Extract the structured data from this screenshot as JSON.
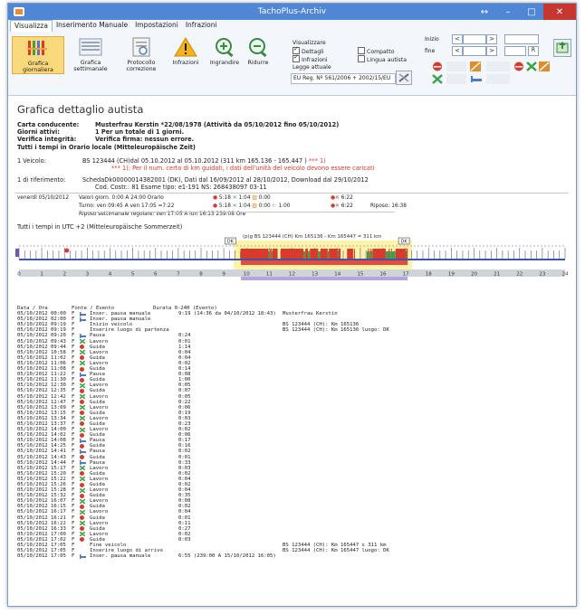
{
  "window": {
    "title": "TachoPlus-Archiv",
    "controls": {
      "extra": "↔",
      "minimize": "–",
      "maximize": "□",
      "close": "✕"
    }
  },
  "menu_tabs": [
    "Visualizza",
    "Inserimento Manuale",
    "Impostazioni",
    "Infrazioni"
  ],
  "toolbar": {
    "buttons": [
      {
        "label": "Grafica giornaliera",
        "icon": "daily-chart-icon"
      },
      {
        "label": "Grafica settimanale",
        "icon": "weekly-chart-icon"
      },
      {
        "label": "Protocollo correzione",
        "icon": "protocol-icon"
      },
      {
        "label": "Infrazioni",
        "icon": "warning-icon"
      },
      {
        "label": "Ingrandire",
        "icon": "zoom-in-icon"
      },
      {
        "label": "Ridurre",
        "icon": "zoom-out-icon"
      }
    ],
    "visualizzare": {
      "title": "Visualizzare",
      "options": [
        {
          "label": "Dettagli",
          "checked": true
        },
        {
          "label": "Compatto",
          "checked": false
        },
        {
          "label": "Infrazioni",
          "checked": true
        },
        {
          "label": "Lingua autista",
          "checked": false
        }
      ],
      "legge_label": "Legge attuale",
      "legge_value": "EU Reg. Nº 561/2006 + 2002/15/EU"
    },
    "range": {
      "inizio_label": "Inizio",
      "fine_label": "fine",
      "nav_prev": "<",
      "nav_next": ">",
      "r_button": "R"
    }
  },
  "report": {
    "title": "Grafica dettaglio autista",
    "conducente_label": "Carta conducente:",
    "conducente_value": "Musterfrau Kerstin *22/08/1978  (Attività da 05/10/2012 fino 05/10/2012)",
    "giorni_label": "Giorni attivi:",
    "giorni_value": "1 Per un totale di 1 giorni.",
    "verifica_label": "Verifica integrità:",
    "verifica_value": "Verifica firma: nessun errore.",
    "tempi": "Tutti i tempi in Orario locale (Mitteleuropäische Zeit)",
    "veicolo_label": "1 Veicolo:",
    "veicolo_value": "BS 123444 (CH)dal 05.10.2012 al 05.10.2012 (311 km  165.136 - 165.447 )",
    "veicolo_note_ref": "*** 1)",
    "veicolo_note": "*** 1): Per il num. certo di km guidati, i dati dell'unità del veicolo devono essere caricati",
    "riferimento_label": "1 di riferimento:",
    "riferimento_value": "SchedaDk00000014382001 (DK), Dati dal 16/09/2012 al 28/10/2012, Download dal 29/10/2012",
    "riferimento_value2": "Cod. Costr.: 81 Esame tipo: e1-191 NS: 268438097 03-11",
    "day_label": "venerdì 05/10/2012",
    "valori": "Valori giorn. 0:00 A 24:00 Orario",
    "turno": "Turno: ven 09:45 A ven 17:05 =7:22",
    "riposo": "Riposo settimanale regolare: ven 17:05 A lun 16:13  239:08 Ore",
    "summary1": {
      "guida": "5:18",
      "lavoro": "1:04",
      "disp": "0:00",
      "tot": "6:22"
    },
    "summary2": {
      "guida": "5:18",
      "lavoro": "1:04",
      "disp": "0:00",
      "pausa": "1:00",
      "tot": "6:22",
      "riposo": "Riposo: 16:38"
    },
    "utc_note": "Tutti i tempi in UTC +2 (Mitteleuropäische Sommerzeit)"
  },
  "chart_data": {
    "type": "timeline",
    "xlim": [
      0,
      24
    ],
    "ticks": [
      "0",
      "1",
      "2",
      "3",
      "4",
      "5",
      "6",
      "7",
      "8",
      "9",
      "10",
      "11",
      "12",
      "13",
      "14",
      "15",
      "16",
      "17",
      "18",
      "19",
      "20",
      "21",
      "22",
      "23",
      "24"
    ],
    "vehicle_label": "(p)g BS 123444 (CH) Km 165136 - Km 165447 = 311 km",
    "start_marker": "DK",
    "end_marker": "DK",
    "shift_start": 9.75,
    "shift_end": 17.08,
    "colors": {
      "guida": "#d93a2b",
      "lavoro": "#3aa34a",
      "pausa": "#5b6fd8",
      "riposo": "#b6a4de",
      "band": "#e34b3f",
      "highlight": "#fff3a8"
    }
  },
  "events_header": {
    "datetime": "Data / Ora",
    "source": "Fonte / Evento",
    "duration": "Durata 0-24H  (Evento)"
  },
  "events": [
    {
      "dt": "05/10/2012 00:00",
      "src": "F",
      "type": "pausa",
      "ev": "Inser. pausa manuale",
      "dur": "9:19  (14:36 da 04/10/2012 18:43)",
      "right": "Musterfrau Kerstin"
    },
    {
      "dt": "05/10/2012 02:00",
      "src": "F",
      "type": "pausa",
      "ev": "Inser. pausa manuale",
      "dur": "",
      "right": ""
    },
    {
      "dt": "05/10/2012 09:19",
      "src": "F",
      "type": "none",
      "ev": "Inizio veicolo",
      "dur": "",
      "right": "BS 123444 (CH): Km 165136"
    },
    {
      "dt": "05/10/2012 09:19",
      "src": "F",
      "type": "none",
      "ev": "Inserire luogo di partenza",
      "dur": "",
      "right": "BS 123444 (CH): Km 165136  luogo: DK"
    },
    {
      "dt": "05/10/2012 09:20",
      "src": "F",
      "type": "pausa",
      "ev": "Pausa",
      "dur": "0:24",
      "right": ""
    },
    {
      "dt": "05/10/2012 09:43",
      "src": "F",
      "type": "lavoro",
      "ev": "Lavoro",
      "dur": "0:01",
      "right": ""
    },
    {
      "dt": "05/10/2012 09:44",
      "src": "F",
      "type": "guida",
      "ev": "Guida",
      "dur": "1:14",
      "right": ""
    },
    {
      "dt": "05/10/2012 10:58",
      "src": "F",
      "type": "lavoro",
      "ev": "Lavoro",
      "dur": "0:04",
      "right": ""
    },
    {
      "dt": "05/10/2012 11:02",
      "src": "F",
      "type": "guida",
      "ev": "Guida",
      "dur": "0:04",
      "right": ""
    },
    {
      "dt": "05/10/2012 11:06",
      "src": "F",
      "type": "lavoro",
      "ev": "Lavoro",
      "dur": "0:02",
      "right": ""
    },
    {
      "dt": "05/10/2012 11:08",
      "src": "F",
      "type": "guida",
      "ev": "Guida",
      "dur": "0:14",
      "right": ""
    },
    {
      "dt": "05/10/2012 11:22",
      "src": "F",
      "type": "pausa",
      "ev": "Pausa",
      "dur": "0:08",
      "right": ""
    },
    {
      "dt": "05/10/2012 11:30",
      "src": "F",
      "type": "guida",
      "ev": "Guida",
      "dur": "1:00",
      "right": ""
    },
    {
      "dt": "05/10/2012 12:30",
      "src": "F",
      "type": "lavoro",
      "ev": "Lavoro",
      "dur": "0:05",
      "right": ""
    },
    {
      "dt": "05/10/2012 12:35",
      "src": "F",
      "type": "guida",
      "ev": "Guida",
      "dur": "0:07",
      "right": ""
    },
    {
      "dt": "05/10/2012 12:42",
      "src": "F",
      "type": "lavoro",
      "ev": "Lavoro",
      "dur": "0:05",
      "right": ""
    },
    {
      "dt": "05/10/2012 12:47",
      "src": "F",
      "type": "guida",
      "ev": "Guida",
      "dur": "0:22",
      "right": ""
    },
    {
      "dt": "05/10/2012 13:09",
      "src": "F",
      "type": "lavoro",
      "ev": "Lavoro",
      "dur": "0:06",
      "right": ""
    },
    {
      "dt": "05/10/2012 13:15",
      "src": "F",
      "type": "guida",
      "ev": "Guida",
      "dur": "0:19",
      "right": ""
    },
    {
      "dt": "05/10/2012 13:34",
      "src": "F",
      "type": "lavoro",
      "ev": "Lavoro",
      "dur": "0:03",
      "right": ""
    },
    {
      "dt": "05/10/2012 13:37",
      "src": "F",
      "type": "guida",
      "ev": "Guida",
      "dur": "0:23",
      "right": ""
    },
    {
      "dt": "05/10/2012 14:00",
      "src": "F",
      "type": "lavoro",
      "ev": "Lavoro",
      "dur": "0:02",
      "right": ""
    },
    {
      "dt": "05/10/2012 14:02",
      "src": "F",
      "type": "guida",
      "ev": "Guida",
      "dur": "0:06",
      "right": ""
    },
    {
      "dt": "05/10/2012 14:08",
      "src": "F",
      "type": "pausa",
      "ev": "Pausa",
      "dur": "0:17",
      "right": ""
    },
    {
      "dt": "05/10/2012 14:25",
      "src": "F",
      "type": "guida",
      "ev": "Guida",
      "dur": "0:16",
      "right": ""
    },
    {
      "dt": "05/10/2012 14:41",
      "src": "F",
      "type": "pausa",
      "ev": "Pausa",
      "dur": "0:02",
      "right": ""
    },
    {
      "dt": "05/10/2012 14:43",
      "src": "F",
      "type": "guida",
      "ev": "Guida",
      "dur": "0:01",
      "right": ""
    },
    {
      "dt": "05/10/2012 14:44",
      "src": "F",
      "type": "pausa",
      "ev": "Pausa",
      "dur": "0:33",
      "right": ""
    },
    {
      "dt": "05/10/2012 15:17",
      "src": "F",
      "type": "lavoro",
      "ev": "Lavoro",
      "dur": "0:03",
      "right": ""
    },
    {
      "dt": "05/10/2012 15:20",
      "src": "F",
      "type": "guida",
      "ev": "Guida",
      "dur": "0:02",
      "right": ""
    },
    {
      "dt": "05/10/2012 15:22",
      "src": "F",
      "type": "lavoro",
      "ev": "Lavoro",
      "dur": "0:04",
      "right": ""
    },
    {
      "dt": "05/10/2012 15:26",
      "src": "F",
      "type": "guida",
      "ev": "Guida",
      "dur": "0:02",
      "right": ""
    },
    {
      "dt": "05/10/2012 15:28",
      "src": "F",
      "type": "lavoro",
      "ev": "Lavoro",
      "dur": "0:04",
      "right": ""
    },
    {
      "dt": "05/10/2012 15:32",
      "src": "F",
      "type": "guida",
      "ev": "Guida",
      "dur": "0:35",
      "right": ""
    },
    {
      "dt": "05/10/2012 16:07",
      "src": "F",
      "type": "lavoro",
      "ev": "Lavoro",
      "dur": "0:08",
      "right": ""
    },
    {
      "dt": "05/10/2012 16:15",
      "src": "F",
      "type": "guida",
      "ev": "Guida",
      "dur": "0:02",
      "right": ""
    },
    {
      "dt": "05/10/2012 16:17",
      "src": "F",
      "type": "lavoro",
      "ev": "Lavoro",
      "dur": "0:04",
      "right": ""
    },
    {
      "dt": "05/10/2012 16:21",
      "src": "F",
      "type": "guida",
      "ev": "Guida",
      "dur": "0:01",
      "right": ""
    },
    {
      "dt": "05/10/2012 16:22",
      "src": "F",
      "type": "lavoro",
      "ev": "Lavoro",
      "dur": "0:11",
      "right": ""
    },
    {
      "dt": "05/10/2012 16:33",
      "src": "F",
      "type": "guida",
      "ev": "Guida",
      "dur": "0:27",
      "right": ""
    },
    {
      "dt": "05/10/2012 17:00",
      "src": "F",
      "type": "lavoro",
      "ev": "Lavoro",
      "dur": "0:02",
      "right": ""
    },
    {
      "dt": "05/10/2012 17:02",
      "src": "F",
      "type": "guida",
      "ev": "Guida",
      "dur": "0:03",
      "right": ""
    },
    {
      "dt": "05/10/2012 17:05",
      "src": "F",
      "type": "none",
      "ev": "Fine veicolo",
      "dur": "",
      "right": "BS 123444 (CH): Km 165447  s  311 km"
    },
    {
      "dt": "05/10/2012 17:05",
      "src": "F",
      "type": "none",
      "ev": "Inserire luogo di arrivo",
      "dur": "",
      "right": "BS 123444 (CH): Km 165447  luogo: DK"
    },
    {
      "dt": "05/10/2012 17:05",
      "src": "F",
      "type": "pausa",
      "ev": "Inser. pausa manuale",
      "dur": "6:55  (239:00 A 15/10/2012 16:05)",
      "right": ""
    }
  ]
}
